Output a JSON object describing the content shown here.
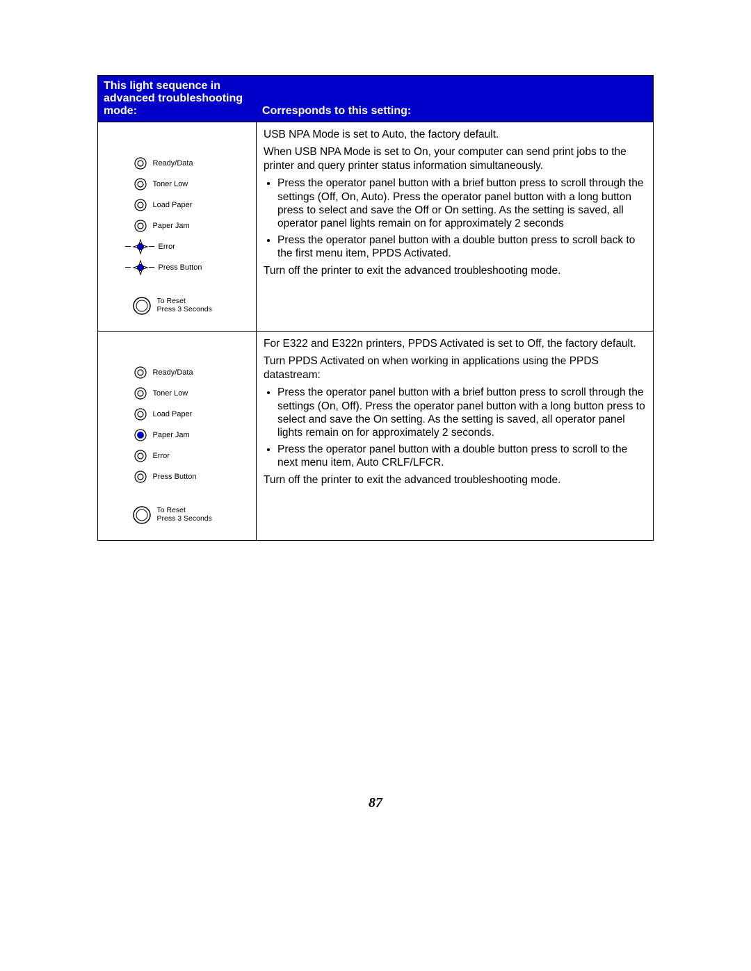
{
  "header": {
    "left": "This light sequence in advanced troubleshooting mode:",
    "right": "Corresponds to this setting:"
  },
  "lights": {
    "ready": "Ready/Data",
    "toner": "Toner Low",
    "load": "Load Paper",
    "jam": "Paper Jam",
    "error": "Error",
    "press": "Press Button",
    "reset1": "To Reset",
    "reset2": "Press 3 Seconds"
  },
  "row1": {
    "p1": "USB NPA Mode is set to Auto, the factory default.",
    "p2": "When USB NPA Mode is set to On, your computer can send print jobs to the printer and query printer status information simultaneously.",
    "b1": "Press the operator panel button with a brief button press to scroll through the settings (Off, On, Auto). Press the operator panel button with a long button press to select and save the Off or On setting. As the setting is saved, all operator panel lights remain on for approximately 2 seconds",
    "b2": "Press the operator panel button with a double button press to scroll back to the first menu item, PPDS Activated.",
    "p3": "Turn off the printer to exit the advanced troubleshooting mode."
  },
  "row2": {
    "p1": "For E322 and E322n printers, PPDS Activated is set to Off, the factory default.",
    "p2": "Turn PPDS Activated on when working in applications using the PPDS datastream:",
    "b1": "Press the operator panel button with a brief button press to scroll through the settings (On, Off). Press the operator panel button with a long button press to select and save the On setting. As the setting is saved, all operator panel lights remain on for approximately 2 seconds.",
    "b2": "Press the operator panel button with a double button press to scroll to the next menu item, Auto CRLF/LFCR.",
    "p3": "Turn off the printer to exit the advanced troubleshooting mode."
  },
  "page_number": "87"
}
